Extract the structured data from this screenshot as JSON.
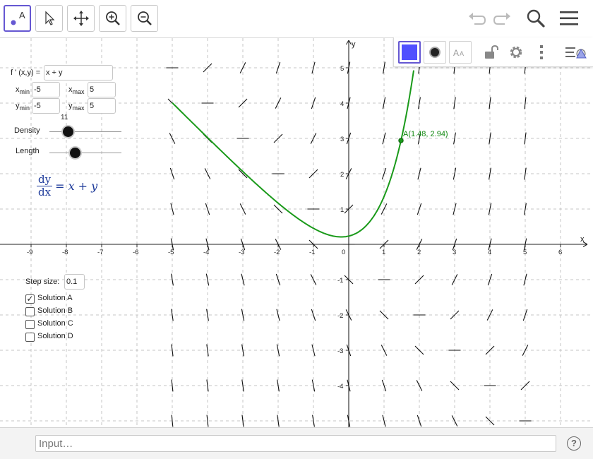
{
  "toolbar": {
    "tools": [
      "move-graphics-tool",
      "select-tool",
      "pan-tool",
      "zoom-in-tool",
      "zoom-out-tool"
    ],
    "move_tool_letter": "A"
  },
  "panel": {
    "fprime_label": "f ' (x,y) =",
    "fprime_value": "x + y",
    "xmin_label": "x",
    "xmin_sub": "min",
    "xmin_value": "-5",
    "xmax_label": "x",
    "xmax_sub": "max",
    "xmax_value": "5",
    "ymin_label": "y",
    "ymin_sub": "min",
    "ymin_value": "-5",
    "ymax_label": "y",
    "ymax_sub": "max",
    "ymax_value": "5",
    "density_label": "Density",
    "density_value": "11",
    "length_label": "Length",
    "formula_num": "dy",
    "formula_den": "dx",
    "formula_rhs": "= x + y",
    "step_label": "Step size:",
    "step_value": "0.1",
    "solutions": [
      {
        "label": "Solution A",
        "checked": true
      },
      {
        "label": "Solution B",
        "checked": false
      },
      {
        "label": "Solution C",
        "checked": false
      },
      {
        "label": "Solution D",
        "checked": false
      }
    ],
    "point_label": "A(1.48, 2.94)"
  },
  "axes": {
    "x_label": "x",
    "y_label": "y",
    "x_ticks": [
      "-9",
      "-8",
      "-7",
      "-6",
      "-5",
      "-4",
      "-3",
      "-2",
      "-1",
      "0",
      "1",
      "2",
      "3",
      "4",
      "5",
      "6"
    ],
    "y_ticks_pos": [
      "1",
      "2",
      "3",
      "4",
      "5"
    ],
    "y_ticks_neg": [
      "-1",
      "-2",
      "-3",
      "-4"
    ]
  },
  "colors": {
    "curve": "#1a9a1a",
    "accent": "#6557d2",
    "style_color": "#5050ff"
  },
  "input": {
    "placeholder": "Input…",
    "help": "?"
  }
}
